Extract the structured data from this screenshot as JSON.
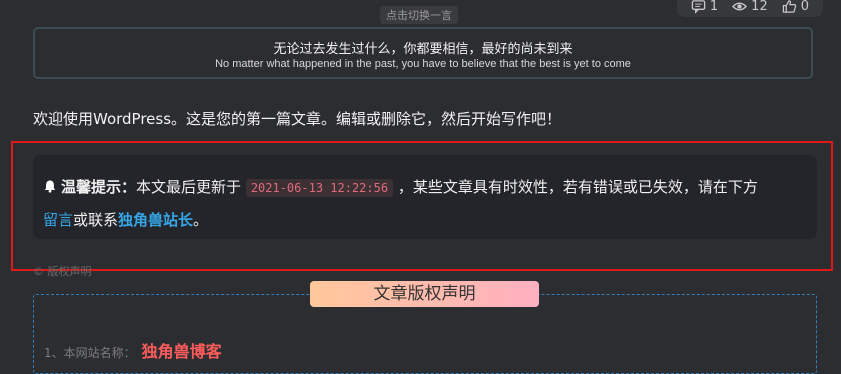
{
  "stats": {
    "comments": "1",
    "views": "12",
    "likes": "0"
  },
  "icons": {
    "comment": "comment-icon",
    "view": "eye-icon",
    "like": "thumbs-up-icon",
    "bell": "bell-icon"
  },
  "quote": {
    "refresh_label": "点击切换一言",
    "zh": "无论过去发生过什么，你都要相信，最好的尚未到来",
    "en": "No matter what happened in the past, you have to believe that the best is yet to come"
  },
  "post": {
    "welcome": "欢迎使用WordPress。这是您的第一篇文章。编辑或删除它，然后开始写作吧！"
  },
  "notice": {
    "title": "温馨提示：",
    "prefix": "本文最后更新于",
    "date": "2021-06-13 12:22:56",
    "middle": "，某些文章具有时效性，若有错误或已失效，请在下方",
    "comment_link": "留言",
    "or_contact": "或联系",
    "author_link": "独角兽站长",
    "end": "。"
  },
  "copyright": {
    "small_label": "© 版权声明",
    "title": "文章版权声明",
    "row1_label": "1、本网站名称：",
    "row1_value": "独角兽博客"
  },
  "colors": {
    "accent": "#35a6e8",
    "highlight": "#e01818",
    "site_name": "#ff5c5c"
  }
}
